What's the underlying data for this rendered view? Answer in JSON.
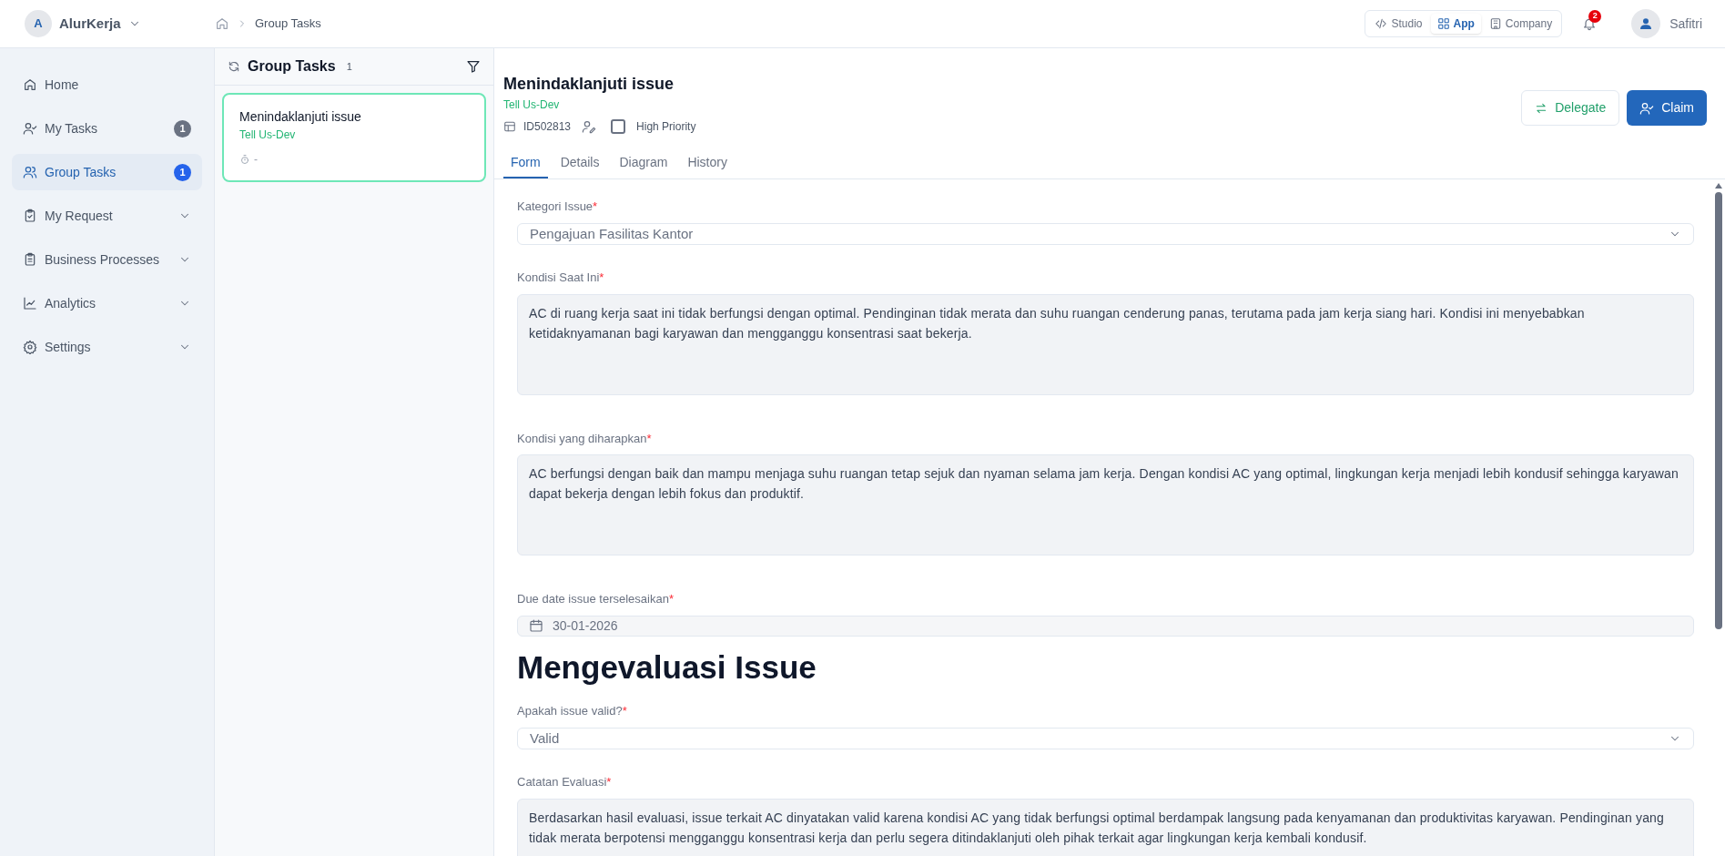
{
  "app": {
    "initial": "A",
    "name": "AlurKerja"
  },
  "breadcrumb": [
    "Group Tasks"
  ],
  "mode_switch": [
    {
      "label": "Studio",
      "kind": "code",
      "selected": false
    },
    {
      "label": "App",
      "kind": "apps",
      "selected": true
    },
    {
      "label": "Company",
      "kind": "building",
      "selected": false
    }
  ],
  "notifications": {
    "count": "2"
  },
  "user": {
    "name": "Safitri"
  },
  "sidebar": {
    "items": [
      {
        "label": "Home",
        "kind": "home",
        "selected": false,
        "expandable": false
      },
      {
        "label": "My Tasks",
        "kind": "user-check",
        "selected": false,
        "expandable": false,
        "badge": "1"
      },
      {
        "label": "Group Tasks",
        "kind": "users",
        "selected": true,
        "expandable": false,
        "badge": "1"
      },
      {
        "label": "My Request",
        "kind": "clipboard-check",
        "selected": false,
        "expandable": true
      },
      {
        "label": "Business Processes",
        "kind": "clipboard-list",
        "selected": false,
        "expandable": true
      },
      {
        "label": "Analytics",
        "kind": "chart",
        "selected": false,
        "expandable": true
      },
      {
        "label": "Settings",
        "kind": "gear",
        "selected": false,
        "expandable": true
      }
    ]
  },
  "task_list": {
    "title": "Group Tasks",
    "count": "1",
    "tasks": [
      {
        "title": "Menindaklanjuti issue",
        "subtitle": "Tell Us-Dev",
        "timer": "-",
        "selected": true
      }
    ]
  },
  "detail": {
    "title": "Menindaklanjuti issue",
    "subtitle": "Tell Us-Dev",
    "id": "ID502813",
    "high_priority": {
      "label": "High Priority",
      "checked": false
    },
    "actions": [
      {
        "label": "Delegate",
        "kind": "secondary"
      },
      {
        "label": "Claim",
        "kind": "primary"
      }
    ],
    "tabs": [
      {
        "label": "Form",
        "selected": true
      },
      {
        "label": "Details",
        "selected": false
      },
      {
        "label": "Diagram",
        "selected": false
      },
      {
        "label": "History",
        "selected": false
      }
    ]
  },
  "form": {
    "fields": [
      {
        "kind": "select",
        "label": "Kategori Issue",
        "required_mark": "*",
        "value": "Pengajuan Fasilitas Kantor"
      },
      {
        "kind": "textarea",
        "label": "Kondisi Saat Ini",
        "required_mark": "*",
        "value": "AC di ruang kerja saat ini tidak berfungsi dengan optimal. Pendinginan tidak merata dan suhu ruangan cenderung panas, terutama pada jam kerja siang hari. Kondisi ini menyebabkan ketidaknyamanan bagi karyawan dan mengganggu konsentrasi saat bekerja."
      },
      {
        "kind": "textarea",
        "label": "Kondisi yang diharapkan",
        "required_mark": "*",
        "value": "AC berfungsi dengan baik dan mampu menjaga suhu ruangan tetap sejuk dan nyaman selama jam kerja. Dengan kondisi AC yang optimal, lingkungan kerja menjadi lebih kondusif sehingga karyawan dapat bekerja dengan lebih fokus dan produktif."
      },
      {
        "kind": "date",
        "label": "Due date issue terselesaikan",
        "required_mark": "*",
        "value": "30-01-2026"
      },
      {
        "kind": "heading",
        "label": "Mengevaluasi Issue"
      },
      {
        "kind": "select",
        "label": "Apakah issue valid?",
        "required_mark": "*",
        "value": "Valid"
      },
      {
        "kind": "textarea",
        "label": "Catatan Evaluasi",
        "required_mark": "*",
        "value": "Berdasarkan hasil evaluasi, issue terkait AC dinyatakan valid karena kondisi AC yang tidak berfungsi optimal berdampak langsung pada kenyamanan dan produktivitas karyawan. Pendinginan yang tidak merata berpotensi mengganggu konsentrasi kerja dan perlu segera ditindaklanjuti oleh pihak terkait agar lingkungan kerja kembali kondusif."
      }
    ]
  }
}
